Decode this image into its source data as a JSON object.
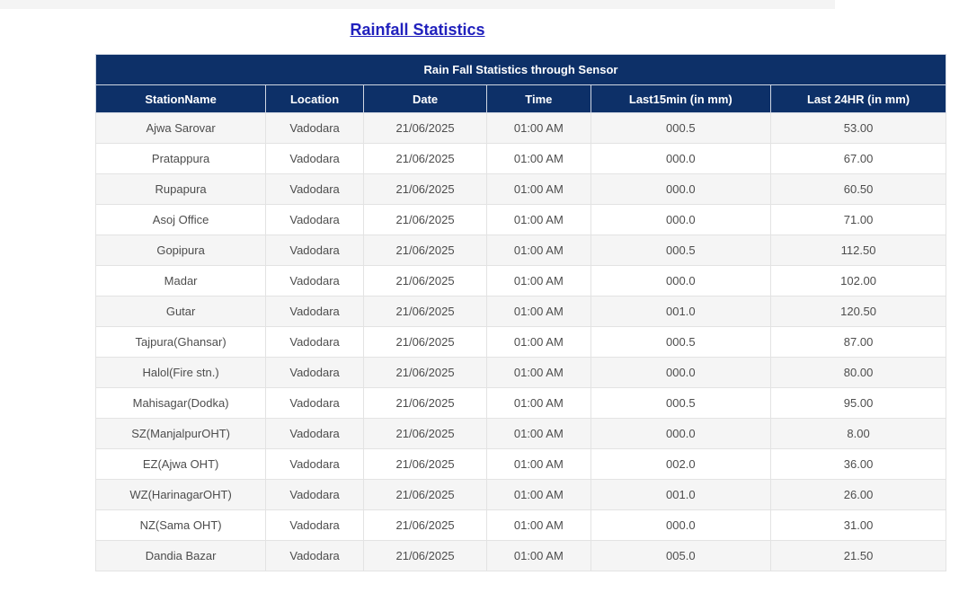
{
  "page": {
    "title_link": "Rainfall Statistics"
  },
  "colors": {
    "header_navy": "#0d3068",
    "title_blue": "#2121bd",
    "row_stripe": "#f5f5f5",
    "row_white": "#ffffff",
    "cell_border": "#e3e3e3",
    "body_text": "#4d4d4d",
    "top_strip": "#f4f4f4"
  },
  "table": {
    "caption": "Rain Fall Statistics through Sensor",
    "columns": [
      "StationName",
      "Location",
      "Date",
      "Time",
      "Last15min (in mm)",
      "Last 24HR (in mm)"
    ],
    "row_fields": [
      "station",
      "location",
      "date",
      "time",
      "last15min",
      "last24hr"
    ],
    "rows": [
      {
        "station": "Ajwa Sarovar",
        "location": "Vadodara",
        "date": "21/06/2025",
        "time": "01:00 AM",
        "last15min": "000.5",
        "last24hr": "53.00"
      },
      {
        "station": "Pratappura",
        "location": "Vadodara",
        "date": "21/06/2025",
        "time": "01:00 AM",
        "last15min": "000.0",
        "last24hr": "67.00"
      },
      {
        "station": "Rupapura",
        "location": "Vadodara",
        "date": "21/06/2025",
        "time": "01:00 AM",
        "last15min": "000.0",
        "last24hr": "60.50"
      },
      {
        "station": "Asoj Office",
        "location": "Vadodara",
        "date": "21/06/2025",
        "time": "01:00 AM",
        "last15min": "000.0",
        "last24hr": "71.00"
      },
      {
        "station": "Gopipura",
        "location": "Vadodara",
        "date": "21/06/2025",
        "time": "01:00 AM",
        "last15min": "000.5",
        "last24hr": "112.50"
      },
      {
        "station": "Madar",
        "location": "Vadodara",
        "date": "21/06/2025",
        "time": "01:00 AM",
        "last15min": "000.0",
        "last24hr": "102.00"
      },
      {
        "station": "Gutar",
        "location": "Vadodara",
        "date": "21/06/2025",
        "time": "01:00 AM",
        "last15min": "001.0",
        "last24hr": "120.50"
      },
      {
        "station": "Tajpura(Ghansar)",
        "location": "Vadodara",
        "date": "21/06/2025",
        "time": "01:00 AM",
        "last15min": "000.5",
        "last24hr": "87.00"
      },
      {
        "station": "Halol(Fire stn.)",
        "location": "Vadodara",
        "date": "21/06/2025",
        "time": "01:00 AM",
        "last15min": "000.0",
        "last24hr": "80.00"
      },
      {
        "station": "Mahisagar(Dodka)",
        "location": "Vadodara",
        "date": "21/06/2025",
        "time": "01:00 AM",
        "last15min": "000.5",
        "last24hr": "95.00"
      },
      {
        "station": "SZ(ManjalpurOHT)",
        "location": "Vadodara",
        "date": "21/06/2025",
        "time": "01:00 AM",
        "last15min": "000.0",
        "last24hr": "8.00"
      },
      {
        "station": "EZ(Ajwa OHT)",
        "location": "Vadodara",
        "date": "21/06/2025",
        "time": "01:00 AM",
        "last15min": "002.0",
        "last24hr": "36.00"
      },
      {
        "station": "WZ(HarinagarOHT)",
        "location": "Vadodara",
        "date": "21/06/2025",
        "time": "01:00 AM",
        "last15min": "001.0",
        "last24hr": "26.00"
      },
      {
        "station": "NZ(Sama OHT)",
        "location": "Vadodara",
        "date": "21/06/2025",
        "time": "01:00 AM",
        "last15min": "000.0",
        "last24hr": "31.00"
      },
      {
        "station": "Dandia Bazar",
        "location": "Vadodara",
        "date": "21/06/2025",
        "time": "01:00 AM",
        "last15min": "005.0",
        "last24hr": "21.50"
      }
    ]
  }
}
